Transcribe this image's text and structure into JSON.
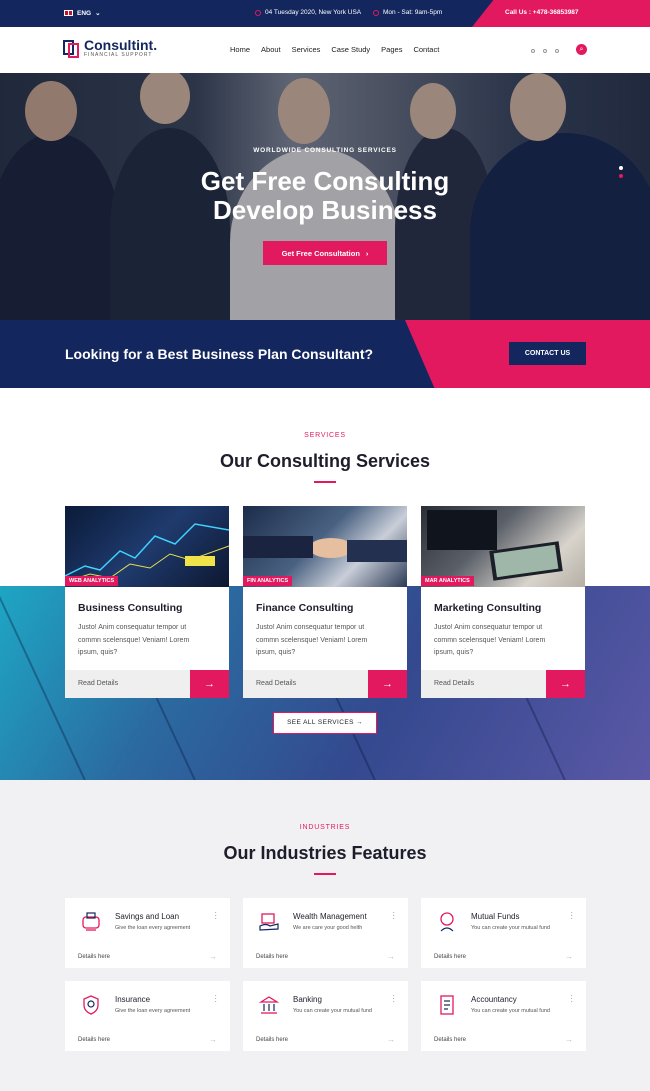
{
  "topbar": {
    "language": "ENG",
    "date_location": "04 Tuesday 2020, New York USA",
    "hours": "Mon - Sat: 9am-5pm",
    "call": "Call Us : +478-36853987"
  },
  "nav": {
    "logo_name": "Consultint.",
    "logo_tagline": "FINANCIAL SUPPORT",
    "menu": [
      "Home",
      "About",
      "Services",
      "Case Study",
      "Pages",
      "Contact"
    ]
  },
  "hero": {
    "eyebrow": "WORLDWIDE CONSULTING SERVICES",
    "title_line1": "Get Free Consulting",
    "title_line2": "Develop Business",
    "button": "Get Free Consultation"
  },
  "cta": {
    "text": "Looking for a Best Business Plan Consultant?",
    "button": "CONTACT US"
  },
  "services": {
    "eyebrow": "SERVICES",
    "title": "Our Consulting Services",
    "cards": [
      {
        "tag": "WEB ANALYTICS",
        "title": "Business Consulting",
        "desc": "Justo! Anim consequatur tempor ut commn scelensque! Veniam! Lorem ipsum, quis?",
        "link": "Read Details"
      },
      {
        "tag": "FIN ANALYTICS",
        "title": "Finance Consulting",
        "desc": "Justo! Anim consequatur tempor ut commn scelensque! Veniam! Lorem ipsum, quis?",
        "link": "Read Details"
      },
      {
        "tag": "MAR ANALYTICS",
        "title": "Marketing Consulting",
        "desc": "Justo! Anim consequatur tempor ut commn scelensque! Veniam! Lorem ipsum, quis?",
        "link": "Read Details"
      }
    ],
    "see_all": "SEE ALL SERVICES"
  },
  "industries": {
    "eyebrow": "INDUSTRIES",
    "title": "Our Industries Features",
    "cards": [
      {
        "title": "Savings and Loan",
        "sub": "Give the loan every agreement",
        "link": "Details here",
        "icon": "piggy-bank-icon"
      },
      {
        "title": "Wealth Management",
        "sub": "We are care your good helth",
        "link": "Details here",
        "icon": "wealth-icon"
      },
      {
        "title": "Mutual Funds",
        "sub": "You can create your mutual fund",
        "link": "Details here",
        "icon": "mutual-funds-icon"
      },
      {
        "title": "Insurance",
        "sub": "Give the loan every agreement",
        "link": "Details here",
        "icon": "insurance-icon"
      },
      {
        "title": "Banking",
        "sub": "You can create your mutual fund",
        "link": "Details here",
        "icon": "banking-icon"
      },
      {
        "title": "Accountancy",
        "sub": "You can create your mutual fund",
        "link": "Details here",
        "icon": "accountancy-icon"
      }
    ]
  },
  "colors": {
    "navy": "#13265e",
    "pink": "#e3195f"
  }
}
